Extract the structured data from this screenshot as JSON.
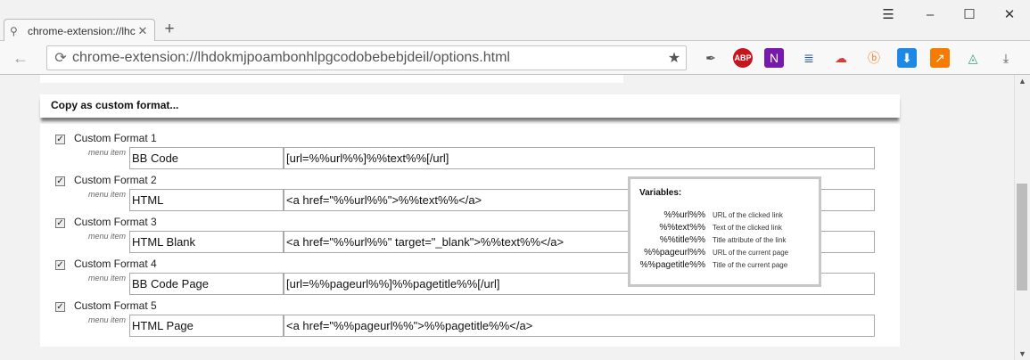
{
  "browser": {
    "tab_title": "chrome-extension://lhc",
    "url": "chrome-extension://lhdokmjpoambonhlpgcodobebebjdeil/options.html"
  },
  "extensions": [
    {
      "name": "feather-icon",
      "glyph": "✒",
      "color": "#555555",
      "bg": "transparent"
    },
    {
      "name": "adblock-plus-icon",
      "glyph": "ABP",
      "color": "#ffffff",
      "bg": "#c4161c"
    },
    {
      "name": "onenote-icon",
      "glyph": "N",
      "color": "#ffffff",
      "bg": "#7719aa"
    },
    {
      "name": "list-icon",
      "glyph": "≣",
      "color": "#2b579a",
      "bg": "transparent"
    },
    {
      "name": "cloud-icon",
      "glyph": "☁",
      "color": "#d83b3b",
      "bg": "transparent"
    },
    {
      "name": "b-circle-icon",
      "glyph": "ⓑ",
      "color": "#f47b20",
      "bg": "transparent"
    },
    {
      "name": "download-square-icon",
      "glyph": "⬇",
      "color": "#ffffff",
      "bg": "#1e88e5"
    },
    {
      "name": "chart-up-icon",
      "glyph": "↗",
      "color": "#ffffff",
      "bg": "#f57c00"
    },
    {
      "name": "triangle-icon",
      "glyph": "◬",
      "color": "#3aa07a",
      "bg": "transparent"
    },
    {
      "name": "download-icon",
      "glyph": "⤓",
      "color": "#555555",
      "bg": "transparent"
    }
  ],
  "section": {
    "title": "Copy as custom format..."
  },
  "menu_item_label": "menu item",
  "formats": [
    {
      "label": "Custom Format 1",
      "name": "BB Code",
      "format": "[url=%%url%%]%%text%%[/url]"
    },
    {
      "label": "Custom Format 2",
      "name": "HTML",
      "format": "<a href=\"%%url%%\">%%text%%</a>"
    },
    {
      "label": "Custom Format 3",
      "name": "HTML Blank",
      "format": "<a href=\"%%url%%\" target=\"_blank\">%%text%%</a>"
    },
    {
      "label": "Custom Format 4",
      "name": "BB Code Page",
      "format": "[url=%%pageurl%%]%%pagetitle%%[/url]"
    },
    {
      "label": "Custom Format 5",
      "name": "HTML Page",
      "format": "<a href=\"%%pageurl%%\">%%pagetitle%%</a>"
    }
  ],
  "variables": {
    "title": "Variables:",
    "items": [
      {
        "name": "%%url%%",
        "desc": "URL of the clicked link"
      },
      {
        "name": "%%text%%",
        "desc": "Text of the clicked link"
      },
      {
        "name": "%%title%%",
        "desc": "Title attribute of the link"
      },
      {
        "name": "%%pageurl%%",
        "desc": "URL of the current page"
      },
      {
        "name": "%%pagetitle%%",
        "desc": "Title of the current page"
      }
    ]
  }
}
